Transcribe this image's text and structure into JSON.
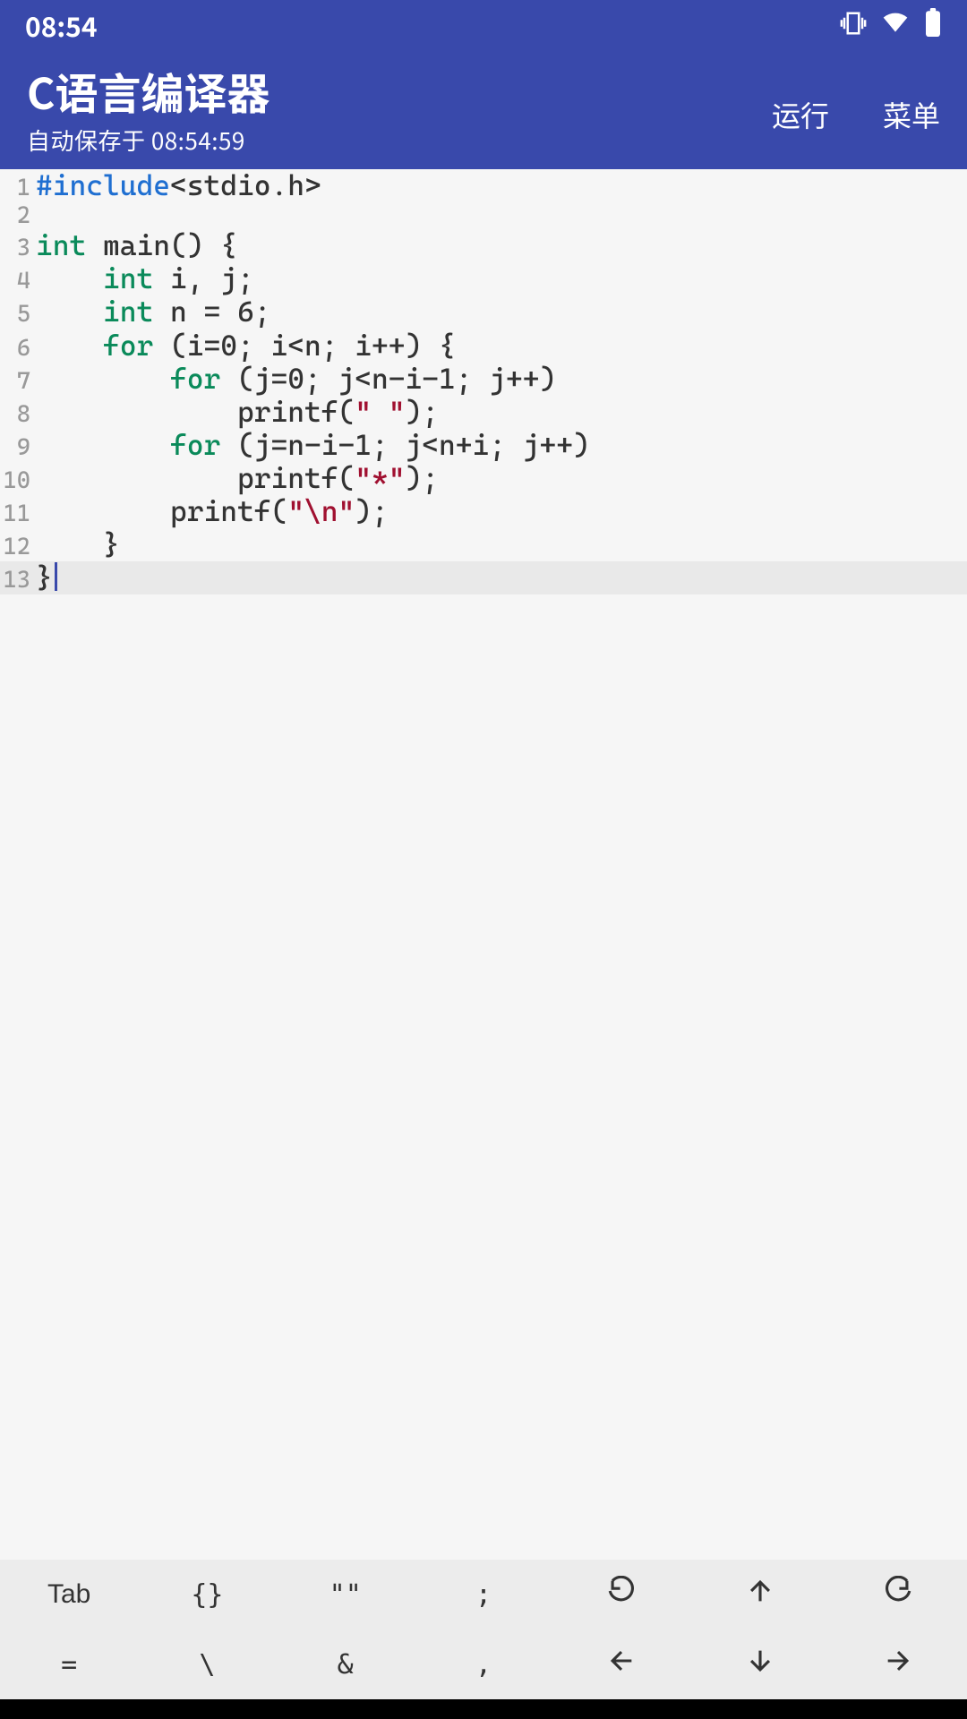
{
  "statusbar": {
    "time": "08:54"
  },
  "header": {
    "title": "C语言编译器",
    "subtitle": "自动保存于 08:54:59",
    "run": "运行",
    "menu": "菜单"
  },
  "code": {
    "cursor_line": 13,
    "lines": [
      {
        "n": "1",
        "tokens": [
          [
            "pre",
            "#include"
          ],
          [
            "inc",
            "<stdio.h>"
          ]
        ]
      },
      {
        "n": "2",
        "tokens": []
      },
      {
        "n": "3",
        "tokens": [
          [
            "kw",
            "int"
          ],
          [
            "txt",
            " main() {"
          ]
        ]
      },
      {
        "n": "4",
        "tokens": [
          [
            "txt",
            "    "
          ],
          [
            "kw",
            "int"
          ],
          [
            "txt",
            " i, j;"
          ]
        ]
      },
      {
        "n": "5",
        "tokens": [
          [
            "txt",
            "    "
          ],
          [
            "kw",
            "int"
          ],
          [
            "txt",
            " n = 6;"
          ]
        ]
      },
      {
        "n": "6",
        "tokens": [
          [
            "txt",
            "    "
          ],
          [
            "kw",
            "for"
          ],
          [
            "txt",
            " (i=0; i<n; i++) {"
          ]
        ]
      },
      {
        "n": "7",
        "tokens": [
          [
            "txt",
            "        "
          ],
          [
            "kw",
            "for"
          ],
          [
            "txt",
            " (j=0; j<n-i-1; j++)"
          ]
        ]
      },
      {
        "n": "8",
        "tokens": [
          [
            "txt",
            "            printf("
          ],
          [
            "str",
            "\" \""
          ],
          [
            "txt",
            ");"
          ]
        ]
      },
      {
        "n": "9",
        "tokens": [
          [
            "txt",
            "        "
          ],
          [
            "kw",
            "for"
          ],
          [
            "txt",
            " (j=n-i-1; j<n+i; j++)"
          ]
        ]
      },
      {
        "n": "10",
        "tokens": [
          [
            "txt",
            "            printf("
          ],
          [
            "str",
            "\"*\""
          ],
          [
            "txt",
            ");"
          ]
        ]
      },
      {
        "n": "11",
        "tokens": [
          [
            "txt",
            "        printf("
          ],
          [
            "str",
            "\"\\n\""
          ],
          [
            "txt",
            ");"
          ]
        ]
      },
      {
        "n": "12",
        "tokens": [
          [
            "txt",
            "    }"
          ]
        ]
      },
      {
        "n": "13",
        "tokens": [
          [
            "txt",
            "}"
          ]
        ]
      }
    ]
  },
  "toolbar": {
    "row1": [
      "Tab",
      "{}",
      "\"\"",
      ";",
      "undo-icon",
      "up-arrow-icon",
      "redo-icon"
    ],
    "row2": [
      "=",
      "\\",
      "&",
      ",",
      "left-arrow-icon",
      "down-arrow-icon",
      "right-arrow-icon"
    ]
  }
}
